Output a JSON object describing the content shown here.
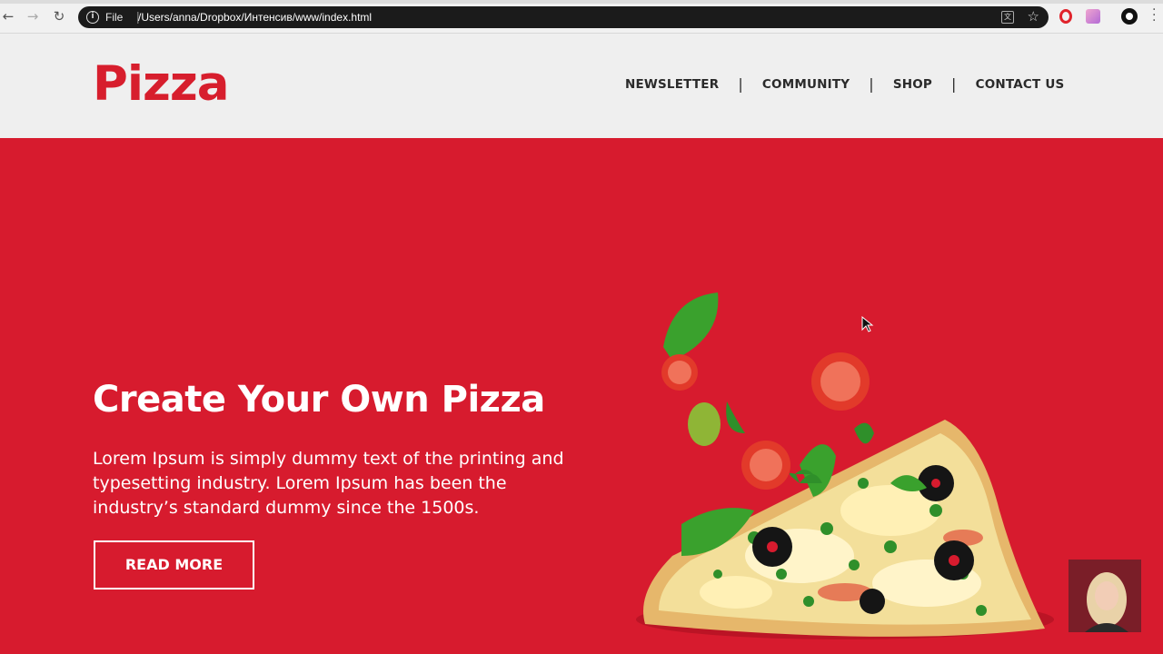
{
  "browser": {
    "scheme": "File",
    "url": "/Users/anna/Dropbox/Интенсив/www/index.html"
  },
  "header": {
    "logo": "Pizza",
    "nav": [
      {
        "label": "NEWSLETTER"
      },
      {
        "label": "COMMUNITY"
      },
      {
        "label": "SHOP"
      },
      {
        "label": "CONTACT US"
      }
    ],
    "nav_divider": "|"
  },
  "hero": {
    "title": "Create Your Own Pizza",
    "text": "Lorem Ipsum is simply dummy text of the printing and typesetting industry. Lorem Ipsum has been the industry’s standard dummy since the 1500s.",
    "button_label": "READ MORE"
  },
  "colors": {
    "brand_red": "#d71b2e",
    "header_bg": "#efefef",
    "nav_text": "#2a2a2a"
  },
  "icons": [
    "back-arrow-icon",
    "forward-arrow-icon",
    "reload-icon",
    "info-icon",
    "translate-icon",
    "star-icon",
    "opera-icon",
    "extension-icon",
    "profile-icon",
    "menu-icon",
    "mouse-cursor-icon"
  ]
}
